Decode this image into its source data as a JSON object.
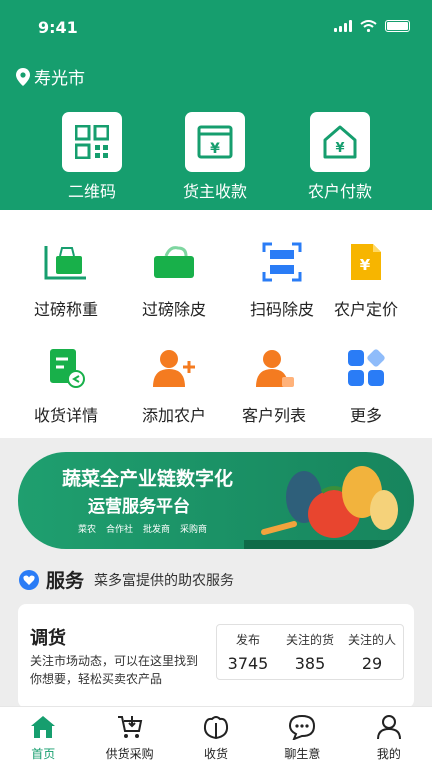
{
  "status_bar": {
    "time": "9:41"
  },
  "location": {
    "city": "寿光市"
  },
  "top_actions": [
    {
      "label": "二维码",
      "icon": "qr-code-icon"
    },
    {
      "label": "货主收款",
      "icon": "receive-payment-icon"
    },
    {
      "label": "农户付款",
      "icon": "farmer-pay-icon"
    }
  ],
  "grid": [
    {
      "label": "过磅称重",
      "icon": "scale-weigh-icon"
    },
    {
      "label": "过磅除皮",
      "icon": "tare-basket-icon"
    },
    {
      "label": "扫码除皮",
      "icon": "scan-tare-icon"
    },
    {
      "label": "农户定价",
      "icon": "price-tag-icon"
    },
    {
      "label": "收货详情",
      "icon": "receipt-detail-icon"
    },
    {
      "label": "添加农户",
      "icon": "add-farmer-icon"
    },
    {
      "label": "客户列表",
      "icon": "customer-list-icon"
    },
    {
      "label": "更多",
      "icon": "more-apps-icon"
    }
  ],
  "banner": {
    "title": "蔬菜全产业链数字化",
    "subtitle": "运营服务平台",
    "tags": [
      "菜农",
      "合作社",
      "批发商",
      "采购商"
    ]
  },
  "services": {
    "title": "服务",
    "subtitle": "菜多富提供的助农服务",
    "card": {
      "title": "调货",
      "description": "关注市场动态，可以在这里找到你想要，轻松买卖农产品",
      "stats": [
        {
          "label": "发布",
          "value": "3745"
        },
        {
          "label": "关注的货",
          "value": "385"
        },
        {
          "label": "关注的人",
          "value": "29"
        }
      ]
    }
  },
  "tabbar": [
    {
      "label": "首页",
      "icon": "home-icon",
      "active": true
    },
    {
      "label": "供货采购",
      "icon": "cart-icon",
      "active": false
    },
    {
      "label": "收货",
      "icon": "cabbage-icon",
      "active": false
    },
    {
      "label": "聊生意",
      "icon": "chat-icon",
      "active": false
    },
    {
      "label": "我的",
      "icon": "user-icon",
      "active": false
    }
  ],
  "colors": {
    "primary": "#169e6e",
    "orange": "#f47b20",
    "blue": "#2a7cf6",
    "yellow": "#f7b500"
  }
}
